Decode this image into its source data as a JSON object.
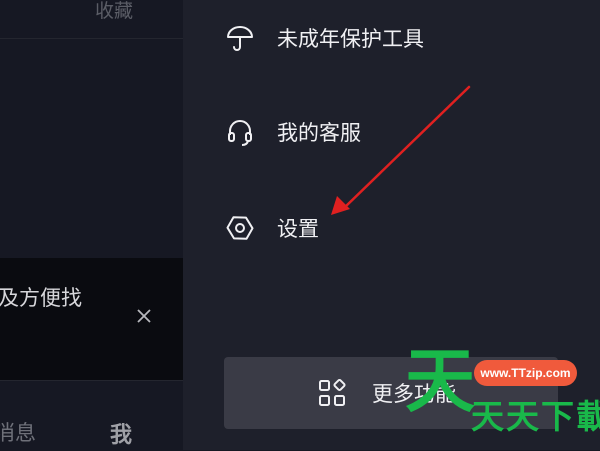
{
  "left_pane": {
    "favorites_label": "收藏",
    "banner_text": "及方便找",
    "nav_messages": "消息",
    "nav_me": "我"
  },
  "drawer": {
    "items": [
      {
        "label": "未成年保护工具",
        "icon": "umbrella-icon"
      },
      {
        "label": "我的客服",
        "icon": "headset-icon"
      },
      {
        "label": "设置",
        "icon": "settings-hexagon-icon"
      }
    ],
    "more_label": "更多功能",
    "more_icon": "grid-apps-icon"
  },
  "annotation": {
    "color": "#e02020",
    "type": "red-arrow"
  },
  "watermark": {
    "big_char": "天",
    "url": "www.TTzip.com",
    "name": "天天下載"
  },
  "colors": {
    "background": "#161823",
    "drawer": "#1e202b",
    "button": "#3a3b46",
    "watermark_green": "#19b94a",
    "watermark_orange": "#f05a3c"
  }
}
